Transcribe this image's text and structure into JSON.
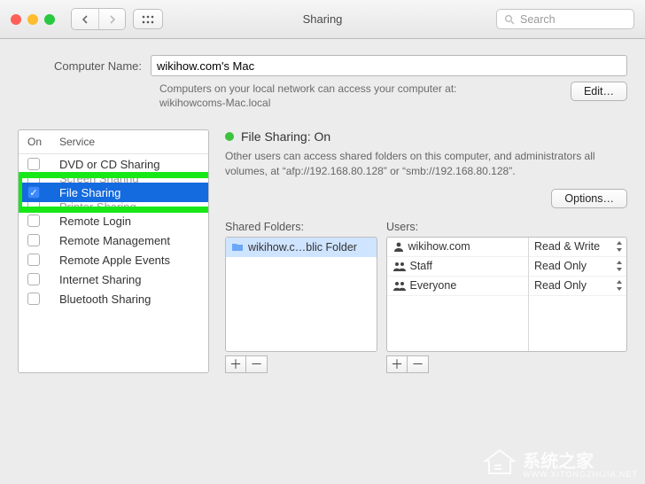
{
  "window": {
    "title": "Sharing",
    "search_placeholder": "Search"
  },
  "computer": {
    "label": "Computer Name:",
    "value": "wikihow.com's Mac",
    "help_line1": "Computers on your local network can access your computer at:",
    "help_line2": "wikihowcoms-Mac.local",
    "edit_button": "Edit…"
  },
  "svc_head": {
    "on": "On",
    "service": "Service"
  },
  "services": [
    {
      "label": "DVD or CD Sharing",
      "on": false
    },
    {
      "label": "Screen Sharing",
      "on": false
    },
    {
      "label": "File Sharing",
      "on": true,
      "selected": true
    },
    {
      "label": "Printer Sharing",
      "on": false
    },
    {
      "label": "Remote Login",
      "on": false
    },
    {
      "label": "Remote Management",
      "on": false
    },
    {
      "label": "Remote Apple Events",
      "on": false
    },
    {
      "label": "Internet Sharing",
      "on": false
    },
    {
      "label": "Bluetooth Sharing",
      "on": false
    }
  ],
  "status": {
    "title": "File Sharing: On",
    "desc": "Other users can access shared folders on this computer, and administrators all volumes, at “afp://192.168.80.128” or “smb://192.168.80.128”.",
    "options_button": "Options…"
  },
  "folders": {
    "label": "Shared Folders:",
    "items": [
      "wikihow.c…blic Folder"
    ]
  },
  "users": {
    "label": "Users:",
    "rows": [
      {
        "name": "wikihow.com",
        "icon": "single",
        "perm": "Read & Write"
      },
      {
        "name": "Staff",
        "icon": "group",
        "perm": "Read Only"
      },
      {
        "name": "Everyone",
        "icon": "group",
        "perm": "Read Only"
      }
    ]
  },
  "watermark": {
    "main": "系统之家",
    "sub": "WWW.XITONGZHIJIA.NET"
  }
}
